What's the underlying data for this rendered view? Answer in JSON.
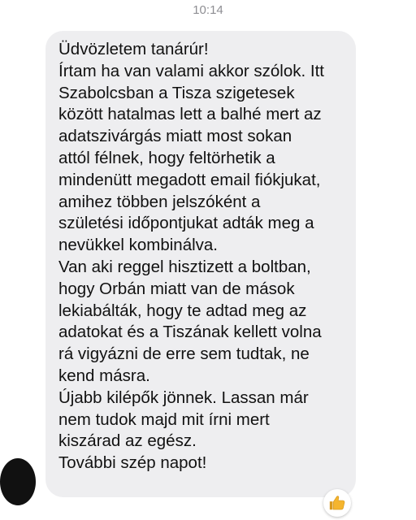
{
  "status": {
    "time": "10:14"
  },
  "message": {
    "lines": [
      "Üdvözletem tanárúr!",
      "Írtam ha van valami akkor szólok. Itt",
      "Szabolcsban a Tisza szigetesek",
      "között hatalmas lett a balhé mert az",
      "adatszivárgás miatt most sokan",
      "attól félnek, hogy feltörhetik a",
      "mindenütt megadott email fiókjukat,",
      "amihez többen jelszóként a",
      "születési időpontjukat adták meg a",
      "nevükkel kombinálva.",
      "Van aki reggel hisztizett a boltban,",
      "hogy Orbán miatt van de mások",
      "lekiabálták, hogy te adtad meg az",
      "adatokat és a Tiszának kellett volna",
      "rá vigyázni de erre sem tudtak, ne",
      "kend másra.",
      "Újabb kilépők jönnek. Lassan már",
      "nem tudok majd mit írni mert",
      "kiszárad az egész.",
      "További szép napot!"
    ]
  },
  "reaction": {
    "icon": "thumbs-up-icon",
    "color": "#f5b52e"
  },
  "colors": {
    "bubble": "#eeeef0",
    "text": "#111111",
    "timestamp": "#8e8e93"
  }
}
